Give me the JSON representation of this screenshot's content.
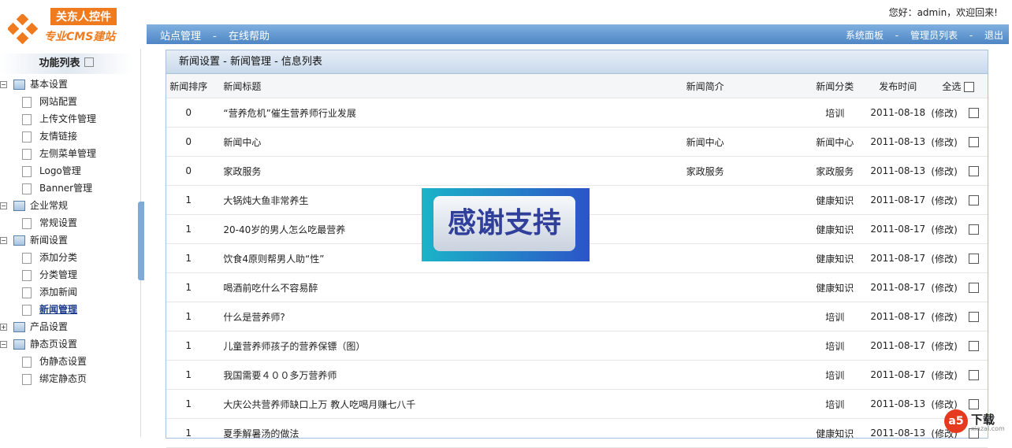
{
  "logo": {
    "top": "关东人控件",
    "bottom": "专业CMS建站"
  },
  "header": {
    "greeting": "您好：admin，欢迎回来!"
  },
  "nav": {
    "left": [
      "站点管理",
      "在线帮助"
    ],
    "right": [
      "系统面板",
      "管理员列表",
      "退出"
    ],
    "sep": "-"
  },
  "sidebar": {
    "title": "功能列表",
    "groups": [
      {
        "label": "基本设置",
        "toggle": "−",
        "items": [
          "网站配置",
          "上传文件管理",
          "友情链接",
          "左侧菜单管理",
          "Logo管理",
          "Banner管理"
        ]
      },
      {
        "label": "企业常规",
        "toggle": "−",
        "items": [
          "常规设置"
        ]
      },
      {
        "label": "新闻设置",
        "toggle": "−",
        "items": [
          "添加分类",
          "分类管理",
          "添加新闻",
          "新闻管理"
        ]
      },
      {
        "label": "产品设置",
        "toggle": "+",
        "items": []
      },
      {
        "label": "静态页设置",
        "toggle": "−",
        "items": [
          "伪静态设置",
          "绑定静态页"
        ]
      }
    ]
  },
  "main": {
    "breadcrumb": "新闻设置 - 新闻管理 - 信息列表",
    "columns": [
      "新闻排序",
      "新闻标题",
      "新闻简介",
      "新闻分类",
      "发布时间",
      "全选"
    ],
    "rows": [
      {
        "order": "0",
        "title": "“营养危机”催生营养师行业发展",
        "intro": "",
        "category": "培训",
        "date": "2011-08-18",
        "edit": "(修改)"
      },
      {
        "order": "0",
        "title": "新闻中心",
        "intro": "新闻中心",
        "category": "新闻中心",
        "date": "2011-08-13",
        "edit": "(修改)"
      },
      {
        "order": "0",
        "title": "家政服务",
        "intro": "家政服务",
        "category": "家政服务",
        "date": "2011-08-13",
        "edit": "(修改)"
      },
      {
        "order": "1",
        "title": "大锅炖大鱼非常养生",
        "intro": "",
        "category": "健康知识",
        "date": "2011-08-17",
        "edit": "(修改)"
      },
      {
        "order": "1",
        "title": "20-40岁的男人怎么吃最营养",
        "intro": "",
        "category": "健康知识",
        "date": "2011-08-17",
        "edit": "(修改)"
      },
      {
        "order": "1",
        "title": "饮食4原则帮男人助“性”",
        "intro": "",
        "category": "健康知识",
        "date": "2011-08-17",
        "edit": "(修改)"
      },
      {
        "order": "1",
        "title": "喝酒前吃什么不容易醉",
        "intro": "",
        "category": "健康知识",
        "date": "2011-08-17",
        "edit": "(修改)"
      },
      {
        "order": "1",
        "title": "什么是营养师?",
        "intro": "",
        "category": "培训",
        "date": "2011-08-17",
        "edit": "(修改)"
      },
      {
        "order": "1",
        "title": "儿童营养师孩子的营养保镖（图）",
        "intro": "",
        "category": "培训",
        "date": "2011-08-17",
        "edit": "(修改)"
      },
      {
        "order": "1",
        "title": "我国需要４００多万营养师",
        "intro": "",
        "category": "培训",
        "date": "2011-08-17",
        "edit": "(修改)"
      },
      {
        "order": "1",
        "title": "大庆公共营养师缺口上万 教人吃喝月赚七八千",
        "intro": "",
        "category": "培训",
        "date": "2011-08-13",
        "edit": "(修改)"
      },
      {
        "order": "1",
        "title": "夏季解暑汤的做法",
        "intro": "",
        "category": "健康知识",
        "date": "2011-08-13",
        "edit": "(修改)"
      }
    ]
  },
  "overlay": {
    "text": "感谢支持"
  },
  "watermark": {
    "brand": "a5",
    "label": "下载",
    "site": "xiazai.com"
  }
}
